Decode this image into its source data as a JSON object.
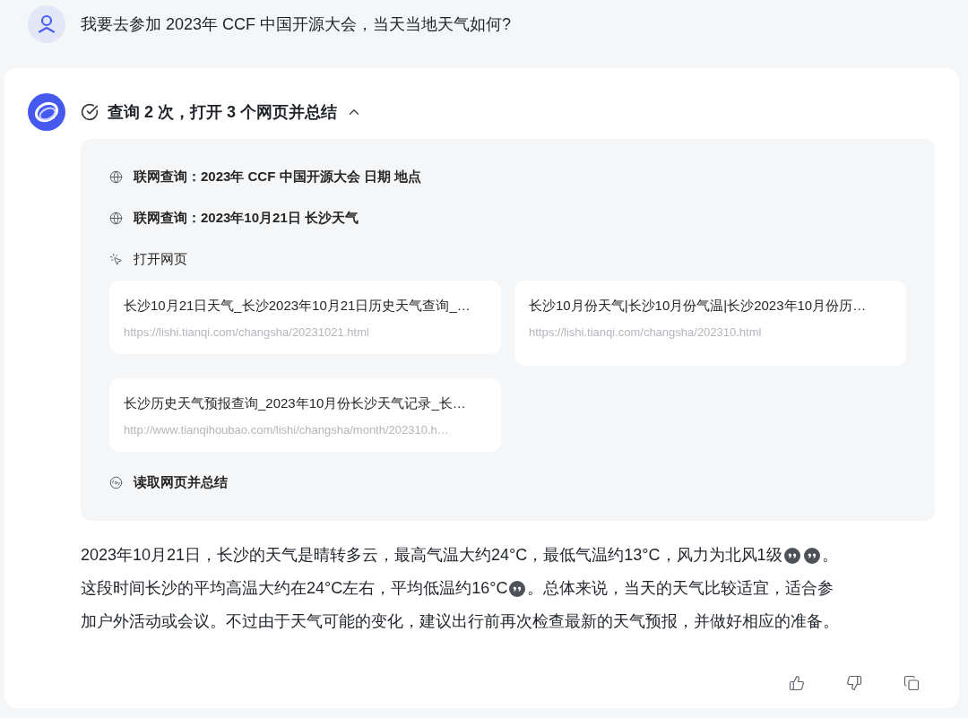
{
  "user_message": {
    "text": "我要去参加 2023年 CCF 中国开源大会，当天当地天气如何?"
  },
  "assistant": {
    "process": {
      "summary": "查询 2 次，打开 3 个网页并总结",
      "expanded": true,
      "steps": [
        {
          "kind": "search",
          "text": "联网查询：2023年 CCF 中国开源大会 日期 地点"
        },
        {
          "kind": "search",
          "text": "联网查询：2023年10月21日 长沙天气"
        },
        {
          "kind": "open",
          "text": "打开网页",
          "pages": [
            {
              "title": "长沙10月21日天气_长沙2023年10月21日历史天气查询_…",
              "url": "https://lishi.tianqi.com/changsha/20231021.html"
            },
            {
              "title": "长沙10月份天气|长沙10月份气温|长沙2023年10月份历…",
              "url": "https://lishi.tianqi.com/changsha/202310.html"
            },
            {
              "title": "长沙历史天气预报查询_2023年10月份长沙天气记录_长…",
              "url": "http://www.tianqihoubao.com/lishi/changsha/month/202310.h…"
            }
          ]
        },
        {
          "kind": "summarize",
          "text": "读取网页并总结"
        }
      ]
    },
    "answer_lines": [
      [
        {
          "kind": "text",
          "text": "2023年10月21日，长沙的天气是晴转多云，最高气温大约24°C，最低气温约13°C，风力为北风1级"
        },
        {
          "kind": "citation"
        },
        {
          "kind": "citation"
        },
        {
          "kind": "text",
          "text": "。"
        }
      ],
      [
        {
          "kind": "text",
          "text": "这段时间长沙的平均高温大约在24°C左右，平均低温约16°C"
        },
        {
          "kind": "citation"
        },
        {
          "kind": "text",
          "text": "。总体来说，当天的天气比较适宜，适合参"
        }
      ],
      [
        {
          "kind": "text",
          "text": "加户外活动或会议。不过由于天气可能的变化，建议出行前再次检查最新的天气预报，并做好相应的准备。"
        }
      ]
    ]
  }
}
